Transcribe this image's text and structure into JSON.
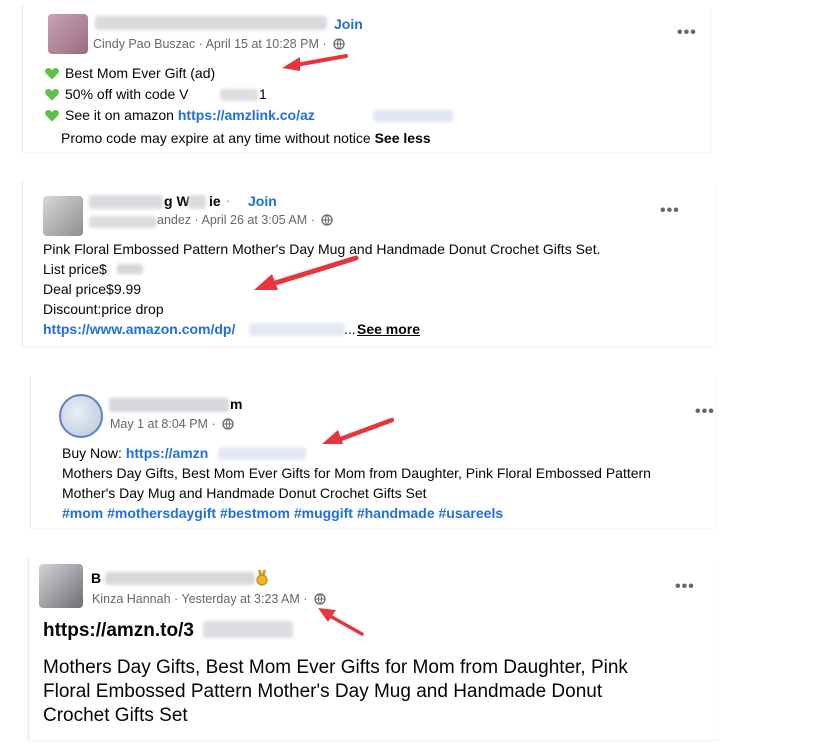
{
  "posts": [
    {
      "join": "Join",
      "author": "Cindy Pao Buszac",
      "timestamp": "April 15 at 10:28 PM",
      "lines": [
        "Best Mom Ever Gift  (ad)",
        "50% off with code V",
        "See it on amazon",
        "Promo code may expire at any time without notice"
      ],
      "code_tail": "1",
      "link": "https://amzlink.co/az",
      "see_less": "See less"
    },
    {
      "group_name_partial": "g W",
      "group_name_partial2": "ie",
      "join": "Join",
      "author_partial": "andez",
      "timestamp": "April 26 at 3:05 AM",
      "lines": [
        "Pink Floral Embossed Pattern Mother's Day Mug and Handmade Donut Crochet Gifts Set.",
        "List price$",
        "Deal price$9.99",
        "Discount:price drop"
      ],
      "link": "https://www.amazon.com/dp/",
      "ellipsis": "...",
      "see_more": "See more"
    },
    {
      "name_partial": "m",
      "timestamp": "May 1 at 8:04 PM",
      "buy_now": "Buy Now:",
      "link": "https://amzn",
      "lines": [
        "Mothers Day Gifts, Best Mom Ever Gifts for Mom from Daughter, Pink Floral Embossed Pattern",
        "Mother's Day Mug and Handmade Donut Crochet Gifts Set"
      ],
      "hashtags": "#mom #mothersdaygift #bestmom #muggift #handmade #usareels"
    },
    {
      "name_partial": "B",
      "author": "Kinza Hannah",
      "timestamp": "Yesterday at 3:23 AM",
      "link": "https://amzn.to/3",
      "lines": [
        "Mothers Day Gifts, Best Mom Ever Gifts for Mom from Daughter, Pink",
        "Floral Embossed Pattern Mother's Day Mug and Handmade Donut",
        "Crochet Gifts Set"
      ]
    }
  ],
  "meta_separator": "·",
  "more_label": "•••",
  "colors": {
    "link": "#216fdb",
    "meta": "#65676b",
    "arrow": "#e8353b",
    "heart": "#5cc146"
  },
  "icons": [
    "globe-icon",
    "heart-icon",
    "more-options-icon",
    "red-arrow-annotation",
    "medal-icon"
  ]
}
